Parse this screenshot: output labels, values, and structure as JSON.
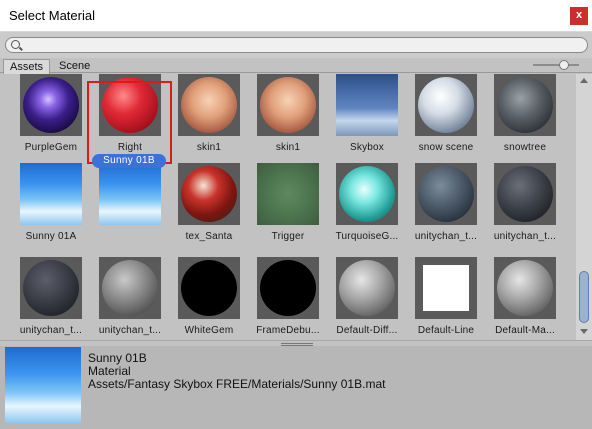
{
  "window": {
    "title": "Select Material",
    "close_label": "x"
  },
  "search": {
    "placeholder": ""
  },
  "tabs": [
    {
      "label": "Assets",
      "active": true
    },
    {
      "label": "Scene",
      "active": false
    }
  ],
  "materials": [
    {
      "label": "PurpleGem",
      "icon": "purple-crystal-sphere"
    },
    {
      "label": "Right",
      "icon": "red-sphere"
    },
    {
      "label": "skin1",
      "icon": "skin-sphere"
    },
    {
      "label": "skin1",
      "icon": "skin-sphere"
    },
    {
      "label": "Skybox",
      "icon": "skybox-flat"
    },
    {
      "label": "snow scene",
      "icon": "snow-sphere"
    },
    {
      "label": "snowtree",
      "icon": "dark-tree-sphere"
    },
    {
      "label": "Sunny 01A",
      "icon": "sky-clouds-flat"
    },
    {
      "label": "Sunny 01B",
      "icon": "sky-clouds-flat",
      "selected": true
    },
    {
      "label": "tex_Santa",
      "icon": "santa-sphere"
    },
    {
      "label": "Trigger",
      "icon": "green-translucent-square"
    },
    {
      "label": "TurquoiseG...",
      "icon": "turquoise-gem-sphere"
    },
    {
      "label": "unitychan_t...",
      "icon": "dark-checker-sphere"
    },
    {
      "label": "unitychan_t...",
      "icon": "dark-checker-sphere"
    },
    {
      "label": "unitychan_t...",
      "icon": "dark-checker-sphere"
    },
    {
      "label": "unitychan_t...",
      "icon": "grey-sphere"
    },
    {
      "label": "WhiteGem",
      "icon": "black-sphere"
    },
    {
      "label": "FrameDebu...",
      "icon": "black-sphere"
    },
    {
      "label": "Default-Diff...",
      "icon": "grey-sphere"
    },
    {
      "label": "Default-Line",
      "icon": "white-square"
    },
    {
      "label": "Default-Ma...",
      "icon": "grey-sphere"
    }
  ],
  "preview": {
    "name": "Sunny 01B",
    "type": "Material",
    "path": "Assets/Fantasy Skybox FREE/Materials/Sunny 01B.mat"
  },
  "colors": {
    "selection_blue": "#3a72d8",
    "selection_frame": "#e01818",
    "close_red": "#c9302c"
  }
}
